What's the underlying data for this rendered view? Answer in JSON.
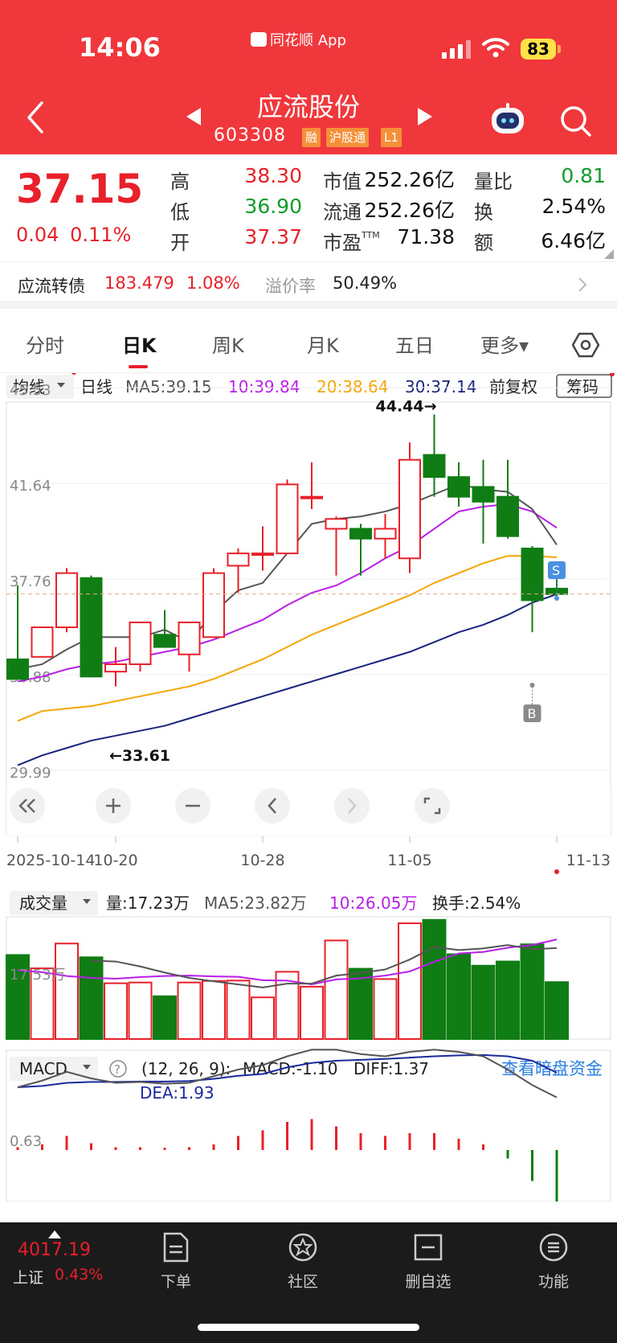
{
  "status": {
    "time": "14:06",
    "app": "同花顺 App",
    "battery": "83"
  },
  "stock": {
    "name": "应流股份",
    "code": "603308",
    "tags": [
      "融",
      "沪股通",
      "L1"
    ]
  },
  "quote": {
    "price": "37.15",
    "change": "0.04",
    "change_pct": "0.11%",
    "high_label": "高",
    "high": "38.30",
    "low_label": "低",
    "low": "36.90",
    "open_label": "开",
    "open": "37.37",
    "mcap_label": "市值",
    "mcap": "252.26亿",
    "float_label": "流通",
    "float": "252.26亿",
    "pe_label": "市盈",
    "pe_sup": "TTM",
    "pe": "71.38",
    "vr_label": "量比",
    "vr": "0.81",
    "turnover_label": "换",
    "turnover": "2.54%",
    "amount_label": "额",
    "amount": "6.46亿"
  },
  "bond": {
    "label": "应流转债",
    "price": "183.479",
    "pct": "1.08%",
    "premium_label": "溢价率",
    "premium": "50.49%"
  },
  "tabs": [
    {
      "label": "分时"
    },
    {
      "label": "日K"
    },
    {
      "label": "周K"
    },
    {
      "label": "月K"
    },
    {
      "label": "五日"
    },
    {
      "label": "更多▾"
    }
  ],
  "kline_header": {
    "indicator": "均线",
    "period": "日线",
    "ma5": "MA5:39.15",
    "ma10": "10:39.84",
    "ma20": "20:38.64",
    "ma30": "30:37.14",
    "adjust": "前复权",
    "chips": "筹码"
  },
  "colors": {
    "up": "#e8202a",
    "down": "#0f7d14",
    "ma5": "#555555",
    "ma10": "#b91ee8",
    "ma20": "#f5a500",
    "ma30": "#1a237e",
    "dif": "#555555",
    "dea": "#1a2a9e"
  },
  "volume_header": {
    "indicator": "成交量",
    "vol": "量:17.23万",
    "ma5": "MA5:23.82万",
    "ma10": "10:26.05万",
    "turnover": "换手:2.54%"
  },
  "macd_header": {
    "indicator": "MACD",
    "params": "(12, 26, 9):",
    "macd": "MACD:-1.10",
    "diff": "DIFF:1.37",
    "dea": "DEA:1.93",
    "link": "查看暗盘资金"
  },
  "chart_data": {
    "type": "candlestick",
    "price_ticks": [
      "45.53",
      "41.64",
      "37.76",
      "33.88",
      "29.99"
    ],
    "price_range": [
      29.99,
      45.53
    ],
    "x_ticks": [
      "2025-10-14",
      "10-20",
      "10-28",
      "11-05",
      "11-13"
    ],
    "annotations": {
      "max": "44.44→",
      "min": "←33.61",
      "sell": "S",
      "buy": "B"
    },
    "candles": [
      {
        "o": 34.5,
        "h": 37.5,
        "l": 33.7,
        "c": 33.7
      },
      {
        "o": 34.6,
        "h": 35.3,
        "l": 34.6,
        "c": 35.8
      },
      {
        "o": 35.8,
        "h": 38.2,
        "l": 35.6,
        "c": 38.0
      },
      {
        "o": 37.8,
        "h": 37.9,
        "l": 33.8,
        "c": 33.8
      },
      {
        "o": 34.0,
        "h": 35.0,
        "l": 33.4,
        "c": 34.3
      },
      {
        "o": 34.3,
        "h": 36.0,
        "l": 34.0,
        "c": 36.0
      },
      {
        "o": 35.5,
        "h": 36.5,
        "l": 35.1,
        "c": 35.0
      },
      {
        "o": 34.7,
        "h": 36.0,
        "l": 34.0,
        "c": 36.0
      },
      {
        "o": 35.4,
        "h": 38.2,
        "l": 35.4,
        "c": 38.0
      },
      {
        "o": 38.3,
        "h": 39.0,
        "l": 37.2,
        "c": 38.8
      },
      {
        "o": 38.8,
        "h": 39.9,
        "l": 38.1,
        "c": 38.8
      },
      {
        "o": 38.8,
        "h": 41.8,
        "l": 38.8,
        "c": 41.6
      },
      {
        "o": 41.1,
        "h": 42.5,
        "l": 40.6,
        "c": 41.1
      },
      {
        "o": 39.8,
        "h": 40.3,
        "l": 37.9,
        "c": 40.2
      },
      {
        "o": 39.8,
        "h": 40.0,
        "l": 37.9,
        "c": 39.4
      },
      {
        "o": 39.4,
        "h": 40.4,
        "l": 38.6,
        "c": 39.8
      },
      {
        "o": 38.6,
        "h": 43.3,
        "l": 38.0,
        "c": 42.6
      },
      {
        "o": 42.8,
        "h": 44.44,
        "l": 41.1,
        "c": 41.9
      },
      {
        "o": 41.9,
        "h": 42.5,
        "l": 40.7,
        "c": 41.1
      },
      {
        "o": 41.5,
        "h": 42.6,
        "l": 39.2,
        "c": 40.9
      },
      {
        "o": 41.1,
        "h": 42.6,
        "l": 39.4,
        "c": 39.5
      },
      {
        "o": 39.0,
        "h": 39.1,
        "l": 35.6,
        "c": 36.9
      },
      {
        "o": 37.37,
        "h": 38.3,
        "l": 36.9,
        "c": 37.15
      }
    ],
    "ma5": [
      34.1,
      34.3,
      34.9,
      35.4,
      35.4,
      35.4,
      35.7,
      35.2,
      36.4,
      37.3,
      37.6,
      38.8,
      40.0,
      40.2,
      40.3,
      40.5,
      40.8,
      41.2,
      41.6,
      41.4,
      41.3,
      40.6,
      39.15
    ],
    "ma10": [
      33.6,
      33.8,
      34.1,
      34.3,
      34.4,
      34.6,
      34.8,
      35.0,
      35.3,
      35.7,
      36.1,
      36.7,
      37.2,
      37.5,
      38.0,
      38.6,
      39.1,
      39.8,
      40.5,
      40.7,
      40.8,
      40.5,
      39.84
    ],
    "ma20": [
      32.0,
      32.4,
      32.5,
      32.6,
      32.8,
      33.0,
      33.2,
      33.4,
      33.7,
      34.1,
      34.5,
      35.0,
      35.5,
      35.9,
      36.3,
      36.7,
      37.1,
      37.6,
      38.0,
      38.4,
      38.7,
      38.7,
      38.64
    ],
    "ma30": [
      30.2,
      30.6,
      30.9,
      31.2,
      31.4,
      31.6,
      31.8,
      32.1,
      32.4,
      32.7,
      33.0,
      33.3,
      33.6,
      33.9,
      34.2,
      34.5,
      34.8,
      35.2,
      35.6,
      35.9,
      36.3,
      36.8,
      37.14
    ],
    "volume_ticks": [
      "17.53万"
    ],
    "volume": [
      22,
      18.5,
      25,
      21.4,
      14.6,
      14.8,
      11.2,
      14.8,
      15.2,
      15.3,
      10.9,
      17.6,
      13.7,
      25.8,
      18.4,
      15.7,
      30.3,
      31.2,
      22.2,
      19.2,
      20.3,
      24.8,
      14.9
    ],
    "vol_ma5": [
      null,
      null,
      null,
      20.5,
      20.3,
      19,
      17.4,
      16,
      15.1,
      14.3,
      13.5,
      14.5,
      14.5,
      16.6,
      17.3,
      18.2,
      20.8,
      24.1,
      23.3,
      23.7,
      24.6,
      23.5,
      23.82
    ],
    "vol_ma10": [
      18,
      17.5,
      16.5,
      16,
      15.8,
      16.2,
      16.5,
      16.6,
      16.4,
      16.3,
      15.4,
      15.3,
      14.3,
      15.6,
      15.9,
      16.6,
      17.7,
      20.2,
      22.4,
      22.8,
      23.9,
      24.6,
      26.05
    ],
    "macd_tick": "0.63",
    "macd_hist": [
      0.05,
      0.1,
      0.25,
      0.12,
      0.05,
      0.05,
      0.04,
      0.05,
      0.1,
      0.25,
      0.35,
      0.5,
      0.55,
      0.42,
      0.3,
      0.25,
      0.3,
      0.3,
      0.2,
      0.1,
      -0.15,
      -0.55,
      -1.1
    ],
    "dif": [
      1.6,
      1.75,
      1.95,
      1.8,
      1.7,
      1.72,
      1.68,
      1.7,
      1.85,
      2.0,
      2.1,
      2.3,
      2.45,
      2.45,
      2.35,
      2.3,
      2.4,
      2.45,
      2.4,
      2.3,
      2.0,
      1.65,
      1.37
    ],
    "dea": [
      1.6,
      1.63,
      1.7,
      1.72,
      1.72,
      1.73,
      1.73,
      1.74,
      1.79,
      1.86,
      1.9,
      2.05,
      2.15,
      2.2,
      2.22,
      2.24,
      2.27,
      2.3,
      2.32,
      2.33,
      2.3,
      2.2,
      1.93
    ]
  },
  "bottom_nav": {
    "index_value": "4017.19",
    "index_name": "上证",
    "index_pct": "0.43%",
    "items": [
      {
        "label": "下单"
      },
      {
        "label": "社区"
      },
      {
        "label": "删自选"
      },
      {
        "label": "功能"
      }
    ]
  }
}
